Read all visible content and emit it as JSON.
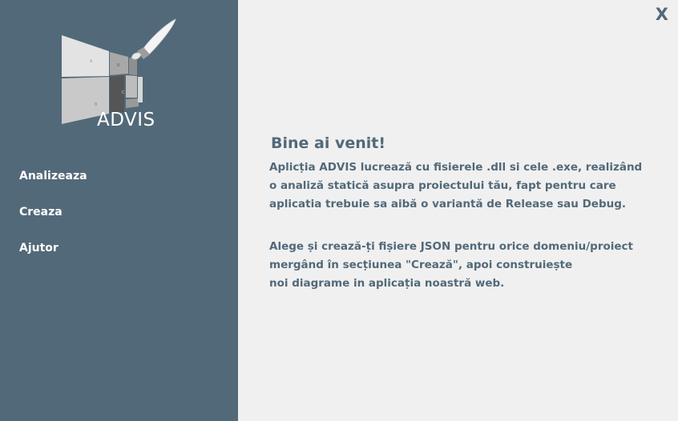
{
  "app": {
    "logo_text": "ADVIS",
    "logo_icon": "paintbrush-grid-logo",
    "close_label": "X"
  },
  "sidebar": {
    "background": "#526979",
    "items": [
      {
        "label": "Analizeaza"
      },
      {
        "label": "Creaza"
      },
      {
        "label": "Ajutor"
      }
    ]
  },
  "main": {
    "background": "#f0f0f0",
    "text_color": "#526979",
    "title": "Bine ai venit!",
    "paragraph1": [
      "Aplicția ADVIS lucrează cu fisierele .dll si cele .exe, realizând",
      "o analiză statică asupra proiectului tău, fapt pentru care",
      "aplicatia trebuie sa aibă o variantă de Release sau Debug."
    ],
    "paragraph2": [
      "Alege și crează-ți fișiere JSON pentru orice domeniu/proiect",
      "mergând în secțiunea \"Crează\", apoi construiește",
      "noi diagrame in aplicația noastră web."
    ]
  }
}
